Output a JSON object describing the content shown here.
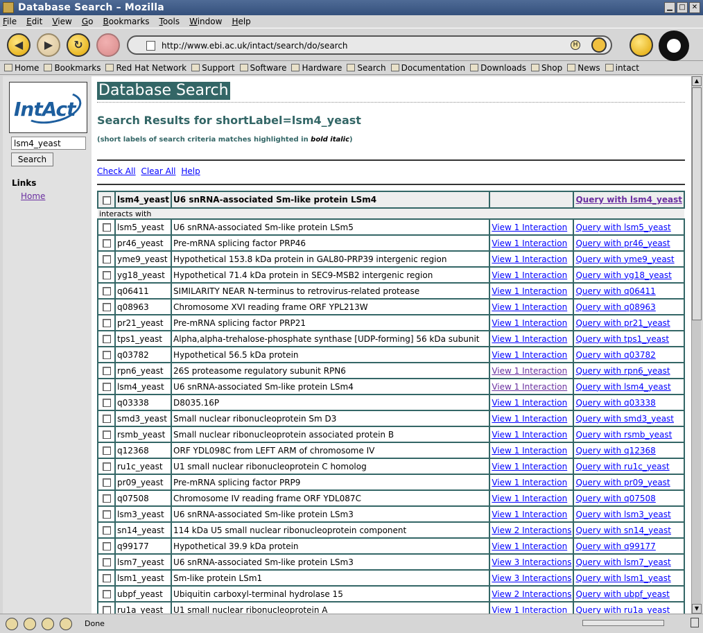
{
  "window": {
    "title": "Database Search – Mozilla"
  },
  "menu": [
    {
      "label": "File",
      "key": "F",
      "rest": "ile"
    },
    {
      "label": "Edit",
      "key": "E",
      "rest": "dit"
    },
    {
      "label": "View",
      "key": "V",
      "rest": "iew"
    },
    {
      "label": "Go",
      "key": "G",
      "rest": "o"
    },
    {
      "label": "Bookmarks",
      "key": "B",
      "rest": "ookmarks"
    },
    {
      "label": "Tools",
      "key": "T",
      "rest": "ools"
    },
    {
      "label": "Window",
      "key": "W",
      "rest": "indow"
    },
    {
      "label": "Help",
      "key": "H",
      "rest": "elp"
    }
  ],
  "address": {
    "url": "http://www.ebi.ac.uk/intact/search/do/search"
  },
  "bookmarks": [
    "Home",
    "Bookmarks",
    "Red Hat Network",
    "Support",
    "Software",
    "Hardware",
    "Search",
    "Documentation",
    "Downloads",
    "Shop",
    "News",
    "intact"
  ],
  "sidebar": {
    "logo_text": "IntAct",
    "search_value": "lsm4_yeast",
    "search_button": "Search",
    "links_heading": "Links",
    "home_link": "Home"
  },
  "page": {
    "title": "Database Search",
    "results_heading": "Search Results for shortLabel=lsm4_yeast",
    "hint_prefix": "(short labels of search criteria matches highlighted in ",
    "hint_em": "bold italic",
    "hint_suffix": ")",
    "check_all": "Check All",
    "clear_all": "Clear All",
    "help": "Help"
  },
  "results": {
    "header": {
      "label": "lsm4_yeast",
      "description": "U6 snRNA-associated Sm-like protein LSm4",
      "query": "Query with lsm4_yeast"
    },
    "interacts_with": "interacts with",
    "rows": [
      {
        "label": "lsm5_yeast",
        "description": "U6 snRNA-associated Sm-like protein LSm5",
        "view": "View 1 Interaction",
        "query": "Query with lsm5_yeast"
      },
      {
        "label": "pr46_yeast",
        "description": "Pre-mRNA splicing factor PRP46",
        "view": "View 1 Interaction",
        "query": "Query with pr46_yeast"
      },
      {
        "label": "yme9_yeast",
        "description": "Hypothetical 153.8 kDa protein in GAL80-PRP39 intergenic region",
        "view": "View 1 Interaction",
        "query": "Query with yme9_yeast"
      },
      {
        "label": "yg18_yeast",
        "description": "Hypothetical 71.4 kDa protein in SEC9-MSB2 intergenic region",
        "view": "View 1 Interaction",
        "query": "Query with yg18_yeast"
      },
      {
        "label": "q06411",
        "description": "SIMILARITY NEAR N-terminus to retrovirus-related protease",
        "view": "View 1 Interaction",
        "query": "Query with q06411"
      },
      {
        "label": "q08963",
        "description": "Chromosome XVI reading frame ORF YPL213W",
        "view": "View 1 Interaction",
        "query": "Query with q08963"
      },
      {
        "label": "pr21_yeast",
        "description": "Pre-mRNA splicing factor PRP21",
        "view": "View 1 Interaction",
        "query": "Query with pr21_yeast"
      },
      {
        "label": "tps1_yeast",
        "description": "Alpha,alpha-trehalose-phosphate synthase [UDP-forming] 56 kDa subunit",
        "view": "View 1 Interaction",
        "query": "Query with tps1_yeast"
      },
      {
        "label": "q03782",
        "description": "Hypothetical 56.5 kDa protein",
        "view": "View 1 Interaction",
        "query": "Query with q03782"
      },
      {
        "label": "rpn6_yeast",
        "description": "26S proteasome regulatory subunit RPN6",
        "view": "View 1 Interaction",
        "query": "Query with rpn6_yeast",
        "visited": true
      },
      {
        "label": "lsm4_yeast",
        "description": "U6 snRNA-associated Sm-like protein LSm4",
        "view": "View 1 Interaction",
        "query": "Query with lsm4_yeast",
        "visited": true
      },
      {
        "label": "q03338",
        "description": "D8035.16P",
        "view": "View 1 Interaction",
        "query": "Query with q03338"
      },
      {
        "label": "smd3_yeast",
        "description": "Small nuclear ribonucleoprotein Sm D3",
        "view": "View 1 Interaction",
        "query": "Query with smd3_yeast"
      },
      {
        "label": "rsmb_yeast",
        "description": "Small nuclear ribonucleoprotein associated protein B",
        "view": "View 1 Interaction",
        "query": "Query with rsmb_yeast"
      },
      {
        "label": "q12368",
        "description": "ORF YDL098C from LEFT ARM of chromosome IV",
        "view": "View 1 Interaction",
        "query": "Query with q12368"
      },
      {
        "label": "ru1c_yeast",
        "description": "U1 small nuclear ribonucleoprotein C homolog",
        "view": "View 1 Interaction",
        "query": "Query with ru1c_yeast"
      },
      {
        "label": "pr09_yeast",
        "description": "Pre-mRNA splicing factor PRP9",
        "view": "View 1 Interaction",
        "query": "Query with pr09_yeast"
      },
      {
        "label": "q07508",
        "description": "Chromosome IV reading frame ORF YDL087C",
        "view": "View 1 Interaction",
        "query": "Query with q07508"
      },
      {
        "label": "lsm3_yeast",
        "description": "U6 snRNA-associated Sm-like protein LSm3",
        "view": "View 1 Interaction",
        "query": "Query with lsm3_yeast"
      },
      {
        "label": "sn14_yeast",
        "description": "114 kDa U5 small nuclear ribonucleoprotein component",
        "view": "View 2 Interactions",
        "query": "Query with sn14_yeast"
      },
      {
        "label": "q99177",
        "description": "Hypothetical 39.9 kDa protein",
        "view": "View 1 Interaction",
        "query": "Query with q99177"
      },
      {
        "label": "lsm7_yeast",
        "description": "U6 snRNA-associated Sm-like protein LSm3",
        "view": "View 3 Interactions",
        "query": "Query with lsm7_yeast"
      },
      {
        "label": "lsm1_yeast",
        "description": "Sm-like protein LSm1",
        "view": "View 3 Interactions",
        "query": "Query with lsm1_yeast"
      },
      {
        "label": "ubpf_yeast",
        "description": "Ubiquitin carboxyl-terminal hydrolase 15",
        "view": "View 2 Interactions",
        "query": "Query with ubpf_yeast"
      },
      {
        "label": "ru1a_yeast",
        "description": "U1 small nuclear ribonucleoprotein A",
        "view": "View 1 Interaction",
        "query": "Query with ru1a_yeast"
      }
    ]
  },
  "status": {
    "text": "Done"
  }
}
